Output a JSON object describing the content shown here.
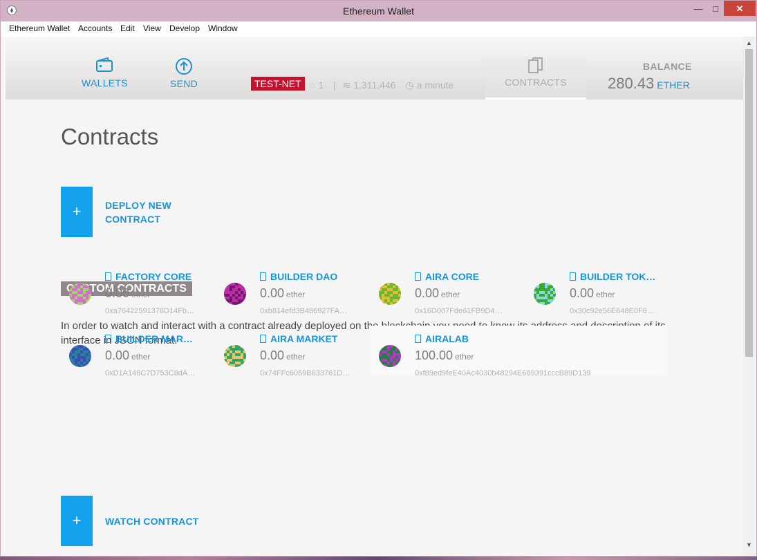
{
  "window": {
    "title": "Ethereum Wallet",
    "minimize": "—",
    "maximize": "□",
    "close": "✕"
  },
  "menu": [
    "Ethereum Wallet",
    "Accounts",
    "Edit",
    "View",
    "Develop",
    "Window"
  ],
  "header": {
    "tabs": {
      "wallets": "WALLETS",
      "send": "SEND",
      "contracts": "CONTRACTS"
    },
    "network": "TEST-NET",
    "peers": "1",
    "separator": "|",
    "block": "1,311,446",
    "last_block": "a minute",
    "balance_label": "BALANCE",
    "balance_value": "280.43",
    "balance_unit": "ETHER"
  },
  "page": {
    "title": "Contracts",
    "deploy_line1": "DEPLOY NEW",
    "deploy_line2": "CONTRACT",
    "plus": "+",
    "section_heading": "CUSTOM CONTRACTS",
    "description": "In order to watch and interact with a contract already deployed on the blockchain you need to know its address and description of its interface in JSON format.",
    "watch_label": "WATCH CONTRACT"
  },
  "contracts": [
    {
      "name": "FACTORY CORE",
      "amount": "0.00",
      "unit": "ether",
      "address": "0xa76422591378D14Fb…",
      "colors": [
        "#9fd46a",
        "#d36fc9"
      ]
    },
    {
      "name": "BUILDER DAO",
      "amount": "0.00",
      "unit": "ether",
      "address": "0xb814efd3B486927FA…",
      "colors": [
        "#6b1a6c",
        "#c02ca3"
      ]
    },
    {
      "name": "AIRA CORE",
      "amount": "0.00",
      "unit": "ether",
      "address": "0x16D007Fde61FB9D4…",
      "colors": [
        "#e0c12a",
        "#6fb53a"
      ]
    },
    {
      "name": "BUILDER TOK…",
      "amount": "0.00",
      "unit": "ether",
      "address": "0x30c92e56E648E0F6…",
      "colors": [
        "#8ad9d9",
        "#3aa832"
      ]
    },
    {
      "name": "BUILDER MAR…",
      "amount": "0.00",
      "unit": "ether",
      "address": "0xD1A148C7D753C8dA…",
      "colors": [
        "#3a4fb5",
        "#2a7f9d"
      ]
    },
    {
      "name": "AIRA MARKET",
      "amount": "0.00",
      "unit": "ether",
      "address": "0x74FFc6059B633761D…",
      "colors": [
        "#e9c66b",
        "#35a366"
      ]
    },
    {
      "name": "AIRALAB",
      "amount": "100.00",
      "unit": "ether",
      "address": "0xf89ed9feE40Ac4030b48294E689391cccB89D139",
      "colors": [
        "#b23ac2",
        "#2a7a4a"
      ]
    }
  ]
}
